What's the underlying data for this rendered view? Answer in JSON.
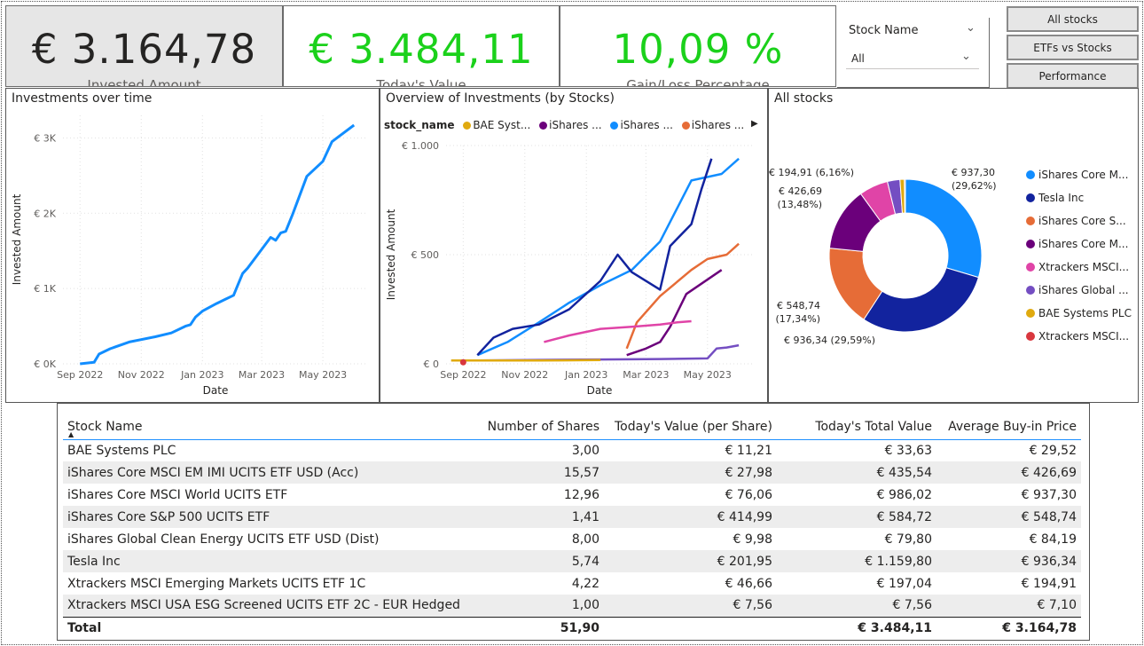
{
  "kpis": [
    {
      "value": "€ 3.164,78",
      "label": "Invested Amount"
    },
    {
      "value": "€ 3.484,11",
      "label": "Today's Value"
    },
    {
      "value": "10,09 %",
      "label": "Gain/Loss Percentage"
    }
  ],
  "slicer": {
    "title": "Stock Name",
    "selected": "All"
  },
  "nav_buttons": [
    "All stocks",
    "ETFs vs Stocks",
    "Performance"
  ],
  "panels": {
    "investments_over_time": "Investments over time",
    "overview_by_stocks": "Overview of Investments (by Stocks)",
    "all_stocks": "All stocks"
  },
  "colors": {
    "kpi_green": "#1bd11b",
    "bae": "#e0aa0f",
    "core_em": "#6b007b",
    "core_world": "#118dff",
    "core_sp500": "#e66c37",
    "clean_energy": "#744ec2",
    "tesla": "#12239e",
    "xtr_em": "#e044a7",
    "xtr_usa": "#d9373e"
  },
  "chart_data": [
    {
      "type": "line",
      "title": "Investments over time",
      "xlabel": "Date",
      "ylabel": "Invested Amount",
      "x_ticks": [
        "Sep 2022",
        "Nov 2022",
        "Jan 2023",
        "Mar 2023",
        "May 2023"
      ],
      "y_ticks": [
        "€ 0K",
        "€ 1K",
        "€ 2K",
        "€ 3K"
      ],
      "x_range": [
        "2022-08-15",
        "2023-06-15"
      ],
      "ylim": [
        0,
        3300
      ],
      "series": [
        {
          "x": [
            "2022-09-01",
            "2022-09-15",
            "2022-09-20",
            "2022-10-01",
            "2022-10-20",
            "2022-11-15",
            "2022-12-01",
            "2022-12-15",
            "2022-12-20",
            "2022-12-25",
            "2023-01-01",
            "2023-01-15",
            "2023-02-01",
            "2023-02-05",
            "2023-02-10",
            "2023-02-15",
            "2023-03-01",
            "2023-03-10",
            "2023-03-15",
            "2023-03-20",
            "2023-03-25",
            "2023-04-01",
            "2023-04-15",
            "2023-05-01",
            "2023-05-10",
            "2023-05-20",
            "2023-06-01"
          ],
          "y": [
            0,
            20,
            130,
            200,
            290,
            360,
            410,
            500,
            520,
            620,
            700,
            800,
            910,
            1040,
            1200,
            1270,
            1520,
            1680,
            1640,
            1740,
            1760,
            1990,
            2490,
            2690,
            2950,
            3050,
            3170
          ]
        }
      ]
    },
    {
      "type": "line",
      "title": "Overview of Investments (by Stocks)",
      "xlabel": "Date",
      "ylabel": "Invested Amount",
      "legend_title": "stock_name",
      "legend_visible": [
        "BAE Syst...",
        "iShares ...",
        "iShares ...",
        "iShares ..."
      ],
      "x_ticks": [
        "Sep 2022",
        "Nov 2022",
        "Jan 2023",
        "Mar 2023",
        "May 2023"
      ],
      "y_ticks": [
        "€ 0",
        "€ 500",
        "€ 1.000"
      ],
      "x_range": [
        "2022-08-15",
        "2023-06-15"
      ],
      "ylim": [
        0,
        1000
      ],
      "series": [
        {
          "key": "core_world",
          "x": [
            "2022-09-15",
            "2022-10-15",
            "2022-11-15",
            "2022-12-15",
            "2023-01-15",
            "2023-02-15",
            "2023-03-15",
            "2023-04-15",
            "2023-05-15",
            "2023-06-01"
          ],
          "y": [
            40,
            100,
            190,
            280,
            360,
            430,
            560,
            840,
            870,
            940
          ]
        },
        {
          "key": "tesla",
          "x": [
            "2022-09-15",
            "2022-10-01",
            "2022-10-20",
            "2022-11-15",
            "2022-12-15",
            "2023-01-15",
            "2023-02-01",
            "2023-02-15",
            "2023-03-15",
            "2023-03-25",
            "2023-04-15",
            "2023-04-25",
            "2023-05-05"
          ],
          "y": [
            40,
            120,
            160,
            180,
            250,
            380,
            500,
            420,
            340,
            540,
            640,
            800,
            940
          ]
        },
        {
          "key": "core_sp500",
          "x": [
            "2023-02-10",
            "2023-02-20",
            "2023-03-15",
            "2023-04-15",
            "2023-05-01",
            "2023-05-20",
            "2023-06-01"
          ],
          "y": [
            70,
            190,
            310,
            430,
            480,
            500,
            550
          ]
        },
        {
          "key": "core_em",
          "x": [
            "2023-02-10",
            "2023-03-01",
            "2023-03-15",
            "2023-03-25",
            "2023-04-10",
            "2023-05-15"
          ],
          "y": [
            40,
            70,
            100,
            170,
            320,
            430
          ]
        },
        {
          "key": "xtr_em",
          "x": [
            "2022-11-20",
            "2022-12-15",
            "2023-01-15",
            "2023-02-15",
            "2023-03-15",
            "2023-04-01",
            "2023-04-15"
          ],
          "y": [
            100,
            130,
            160,
            170,
            180,
            190,
            195
          ]
        },
        {
          "key": "clean_energy",
          "x": [
            "2022-09-15",
            "2022-11-15",
            "2023-01-15",
            "2023-03-15",
            "2023-05-01",
            "2023-05-10",
            "2023-05-20",
            "2023-06-01"
          ],
          "y": [
            15,
            18,
            20,
            22,
            25,
            70,
            75,
            85
          ]
        },
        {
          "key": "bae",
          "x": [
            "2022-08-20",
            "2022-09-20",
            "2022-11-15",
            "2023-01-15"
          ],
          "y": [
            15,
            15,
            15,
            17
          ]
        },
        {
          "key": "xtr_usa",
          "x": [
            "2022-09-01"
          ],
          "y": [
            7
          ]
        }
      ]
    },
    {
      "type": "pie",
      "variant": "donut",
      "title": "All stocks",
      "slices": [
        {
          "key": "core_world",
          "label": "iShares Core M...",
          "value": 937.3,
          "percent": 29.62,
          "data_label": [
            "€ 937,30",
            "(29,62%)"
          ]
        },
        {
          "key": "tesla",
          "label": "Tesla Inc",
          "value": 936.34,
          "percent": 29.59,
          "data_label": [
            "€ 936,34 (29,59%)"
          ]
        },
        {
          "key": "core_sp500",
          "label": "iShares Core S...",
          "value": 548.74,
          "percent": 17.34,
          "data_label": [
            "€ 548,74",
            "(17,34%)"
          ]
        },
        {
          "key": "core_em",
          "label": "iShares Core M...",
          "value": 426.69,
          "percent": 13.48,
          "data_label": [
            "€ 426,69",
            "(13,48%)"
          ]
        },
        {
          "key": "xtr_em",
          "label": "Xtrackers MSCI...",
          "value": 194.91,
          "percent": 6.16,
          "data_label": [
            "€ 194,91 (6,16%)"
          ]
        },
        {
          "key": "clean_energy",
          "label": "iShares Global ...",
          "value": 84.19,
          "percent": 2.66,
          "data_label": []
        },
        {
          "key": "bae",
          "label": "BAE Systems PLC",
          "value": 29.52,
          "percent": 0.93,
          "data_label": []
        },
        {
          "key": "xtr_usa",
          "label": "Xtrackers MSCI...",
          "value": 7.1,
          "percent": 0.22,
          "data_label": []
        }
      ]
    },
    {
      "type": "table",
      "headers": [
        "Stock Name",
        "Number of Shares",
        "Today's Value (per Share)",
        "Today's Total Value",
        "Average Buy-in Price"
      ],
      "rows": [
        [
          "BAE Systems PLC",
          "3,00",
          "€ 11,21",
          "€ 33,63",
          "€ 29,52"
        ],
        [
          "iShares Core MSCI EM IMI UCITS ETF USD (Acc)",
          "15,57",
          "€ 27,98",
          "€ 435,54",
          "€ 426,69"
        ],
        [
          "iShares Core MSCI World UCITS ETF",
          "12,96",
          "€ 76,06",
          "€ 986,02",
          "€ 937,30"
        ],
        [
          "iShares Core S&P 500 UCITS ETF",
          "1,41",
          "€ 414,99",
          "€ 584,72",
          "€ 548,74"
        ],
        [
          "iShares Global Clean Energy UCITS ETF USD (Dist)",
          "8,00",
          "€ 9,98",
          "€ 79,80",
          "€ 84,19"
        ],
        [
          "Tesla Inc",
          "5,74",
          "€ 201,95",
          "€ 1.159,80",
          "€ 936,34"
        ],
        [
          "Xtrackers MSCI Emerging Markets UCITS ETF 1C",
          "4,22",
          "€ 46,66",
          "€ 197,04",
          "€ 194,91"
        ],
        [
          "Xtrackers MSCI USA ESG Screened UCITS ETF 2C - EUR Hedged",
          "1,00",
          "€ 7,56",
          "€ 7,56",
          "€ 7,10"
        ]
      ],
      "total": [
        "Total",
        "51,90",
        "",
        "€ 3.484,11",
        "€ 3.164,78"
      ]
    }
  ]
}
